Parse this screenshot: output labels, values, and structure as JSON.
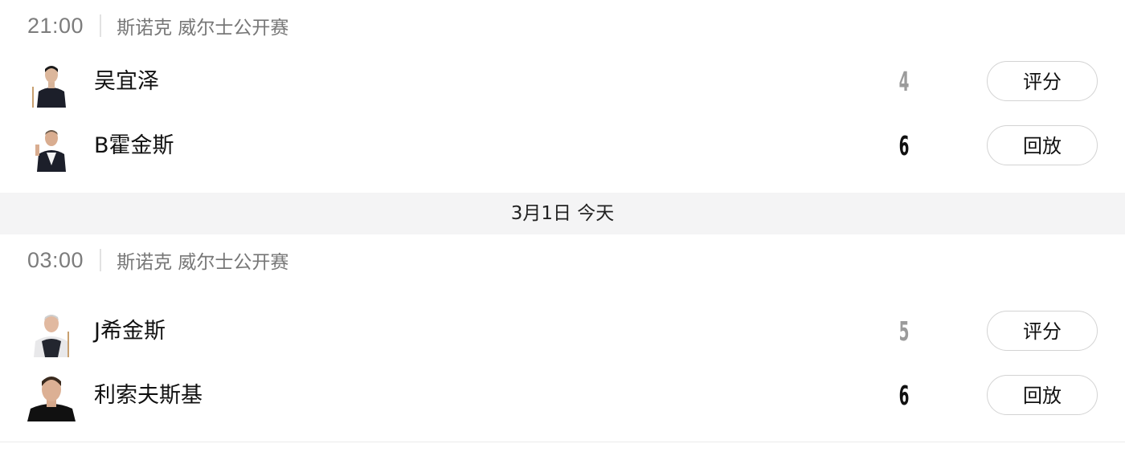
{
  "matches": [
    {
      "time": "21:00",
      "competition": "斯诺克 威尔士公开赛",
      "players": [
        {
          "name": "吴宜泽",
          "score": "4",
          "result": "lose",
          "action": "评分",
          "avatar": "player-avatar"
        },
        {
          "name": "B霍金斯",
          "score": "6",
          "result": "win",
          "action": "回放",
          "avatar": "player-avatar"
        }
      ]
    },
    {
      "time": "03:00",
      "competition": "斯诺克 威尔士公开赛",
      "players": [
        {
          "name": "J希金斯",
          "score": "5",
          "result": "lose",
          "action": "评分",
          "avatar": "player-avatar"
        },
        {
          "name": "利索夫斯基",
          "score": "6",
          "result": "win",
          "action": "回放",
          "avatar": "player-avatar"
        }
      ]
    }
  ],
  "date_divider": "3月1日 今天",
  "colors": {
    "time": "#7c7c7c",
    "competition": "#777777",
    "score_win": "#111111",
    "score_lose": "#9b9b9b",
    "divider_bg": "#f4f4f5",
    "button_border": "#d3d3d3"
  }
}
